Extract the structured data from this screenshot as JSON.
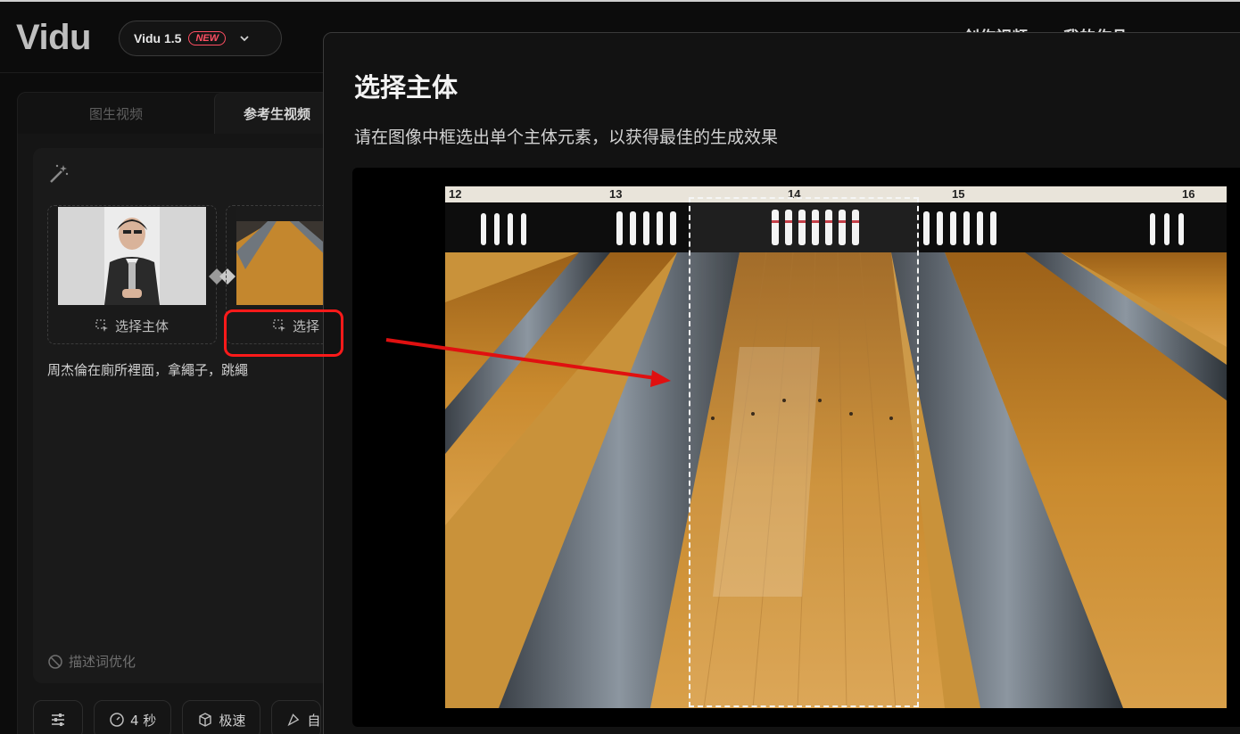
{
  "header": {
    "logo": "Vidu",
    "model": "Vidu 1.5",
    "new_badge": "NEW",
    "nav": [
      "创作视频",
      "我的作品"
    ]
  },
  "left_panel": {
    "tabs": [
      "图生视频",
      "参考生视频"
    ],
    "subject_slots": [
      {
        "select_label": "选择主体"
      },
      {
        "select_label": "选择"
      }
    ],
    "prompt_text": "周杰倫在廁所裡面，拿繩子，跳繩",
    "optimize_label": "描述词优化",
    "chips": [
      {
        "icon": "sliders-icon",
        "label": ""
      },
      {
        "icon": "clock-icon",
        "label": "4 秒"
      },
      {
        "icon": "cube-icon",
        "label": "极速"
      },
      {
        "icon": "paint-icon",
        "label": "自"
      }
    ]
  },
  "modal": {
    "title": "选择主体",
    "description": "请在图像中框选出单个主体元素，以获得最佳的生成效果",
    "lane_numbers": [
      "12",
      "13",
      "14",
      "15",
      "16"
    ]
  },
  "colors": {
    "background": "#0c0c0c",
    "modal_bg": "#121212",
    "annotation_red": "#ff1a1a",
    "badge_red": "#ff4f63",
    "lane_wood": "#c98a2e"
  }
}
